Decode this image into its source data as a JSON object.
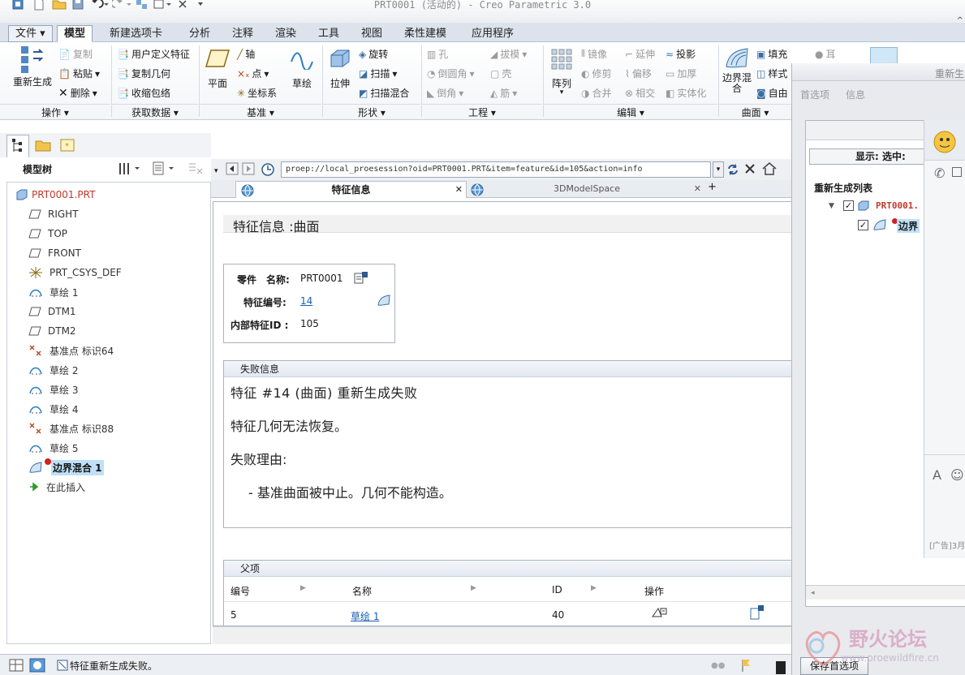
{
  "window": {
    "title": "PRT0001 (活动的) - Creo Parametric 3.0"
  },
  "menu_tabs": [
    "文件",
    "模型",
    "新建选项卡",
    "分析",
    "注释",
    "渲染",
    "工具",
    "视图",
    "柔性建模",
    "应用程序"
  ],
  "ribbon": {
    "regenerate": "重新生成",
    "copy": "复制",
    "paste": "粘贴",
    "delete": "删除",
    "udf": "用户定义特征",
    "copy_geom": "复制几何",
    "shrinkwrap": "收缩包络",
    "plane": "平面",
    "axis": "轴",
    "point": "点",
    "csys": "坐标系",
    "sketch": "草绘",
    "extrude": "拉伸",
    "revolve": "旋转",
    "sweep": "扫描",
    "swept_blend": "扫描混合",
    "hole": "孔",
    "round": "倒圆角",
    "chamfer": "倒角",
    "draft": "拔模",
    "shell": "壳",
    "rib": "筋",
    "pattern": "阵列",
    "mirror": "镜像",
    "trim": "修剪",
    "merge": "合并",
    "extend": "延伸",
    "offset": "偏移",
    "intersect": "相交",
    "project": "投影",
    "thicken": "加厚",
    "solidify": "实体化",
    "boundary_blend": "边界混合",
    "fill": "填充",
    "style": "样式",
    "freestyle": "自由",
    "ear": "耳",
    "groups": [
      "操作",
      "获取数据",
      "基准",
      "形状",
      "工程",
      "编辑",
      "曲面"
    ]
  },
  "model_tree": {
    "header": "模型树",
    "items": [
      {
        "label": "PRT0001.PRT",
        "icon": "part-icon"
      },
      {
        "label": "RIGHT",
        "icon": "datum-plane-icon"
      },
      {
        "label": "TOP",
        "icon": "datum-plane-icon"
      },
      {
        "label": "FRONT",
        "icon": "datum-plane-icon"
      },
      {
        "label": "PRT_CSYS_DEF",
        "icon": "csys-icon"
      },
      {
        "label": "草绘 1",
        "icon": "sketch-icon"
      },
      {
        "label": "DTM1",
        "icon": "datum-plane-icon"
      },
      {
        "label": "DTM2",
        "icon": "datum-plane-icon"
      },
      {
        "label": "基准点 标识64",
        "icon": "datum-point-icon"
      },
      {
        "label": "草绘 2",
        "icon": "sketch-icon"
      },
      {
        "label": "草绘 3",
        "icon": "sketch-icon"
      },
      {
        "label": "草绘 4",
        "icon": "sketch-icon"
      },
      {
        "label": "基准点 标识88",
        "icon": "datum-point-icon"
      },
      {
        "label": "草绘 5",
        "icon": "sketch-icon"
      },
      {
        "label": "边界混合 1",
        "icon": "boundary-blend-icon"
      },
      {
        "label": "在此插入",
        "icon": "insert-here-icon"
      }
    ]
  },
  "browser": {
    "url": "proep://local_proesession?oid=PRT0001.PRT&item=feature&id=105&action=info",
    "tabs": [
      "特征信息",
      "3DModelSpace"
    ]
  },
  "feature_info": {
    "title": "特征信息 :曲面",
    "part_label": "零件",
    "name_label": "名称:",
    "name_value": "PRT0001",
    "feat_no_label": "特征编号:",
    "feat_no_value": "14",
    "internal_id_label": "内部特征ID :",
    "internal_id_value": "105"
  },
  "failure": {
    "header": "失败信息",
    "line1": "特征 #14 (曲面) 重新生成失败",
    "line2": "特征几何无法恢复。",
    "line3": "失败理由:",
    "line4": "- 基准曲面被中止。几何不能构造。"
  },
  "parents": {
    "header": "父项",
    "columns": [
      "编号",
      "名称",
      "ID",
      "操作"
    ],
    "rows": [
      {
        "no": "5",
        "name": "草绘 1",
        "id": "40"
      }
    ]
  },
  "status": {
    "message": "特征重新生成失败。"
  },
  "right_panel": {
    "title": "重新生",
    "tab1": "首选项",
    "tab2": "信息",
    "show_label": "显示: 选中:",
    "list_title": "重新生成列表",
    "item1": "PRT0001.",
    "item2": "边界",
    "save_pref": "保存首选项",
    "ad": "[广告]3月"
  },
  "watermark": {
    "name": "野火论坛",
    "url": "www.proewildfire.cn"
  }
}
